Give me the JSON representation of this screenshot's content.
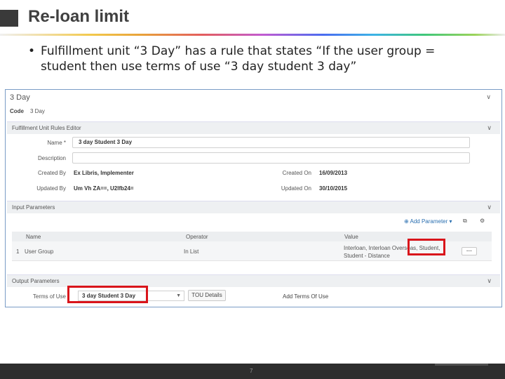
{
  "slide": {
    "title": "Re-loan limit",
    "bullet": "•",
    "bullet_text": "Fulfillment unit “3 Day” has a rule that states “If the user group = student then use terms of use “3 day student 3 day”",
    "page_number": "7"
  },
  "app": {
    "header_title": "3 Day",
    "code_label": "Code",
    "code_value": "3 Day",
    "sections": {
      "rules_editor": "Fulfillment Unit Rules Editor",
      "input_parameters": "Input Parameters",
      "output_parameters": "Output Parameters"
    },
    "form": {
      "name_label": "Name *",
      "name_value": "3 day Student 3 Day",
      "description_label": "Description",
      "description_value": "",
      "created_by_label": "Created By",
      "created_by_value": "Ex Libris, Implementer",
      "created_on_label": "Created On",
      "created_on_value": "16/09/2013",
      "updated_by_label": "Updated By",
      "updated_by_value": "Um Vh ZA==, U2lfb24=",
      "updated_on_label": "Updated On",
      "updated_on_value": "30/10/2015"
    },
    "toolbar": {
      "add_parameter": "Add Parameter",
      "add_icon": "plus-circle-icon",
      "export_icon": "export-icon",
      "settings_icon": "gear-icon"
    },
    "table": {
      "columns": [
        "Name",
        "Operator",
        "Value"
      ],
      "rows": [
        {
          "index": "1",
          "name": "User Group",
          "operator": "In List",
          "value_line1": "Interloan, Interloan Overseas, Student,",
          "value_line2": "Student - Distance",
          "action": "···"
        }
      ]
    },
    "output": {
      "terms_label": "Terms of Use",
      "terms_value": "3 day Student 3 Day",
      "tou_details": "TOU Details",
      "add_terms": "Add Terms Of Use"
    }
  },
  "colors": {
    "highlight": "#d9151b",
    "link": "#2a6fb0",
    "panel_border": "#7a9cc6"
  }
}
